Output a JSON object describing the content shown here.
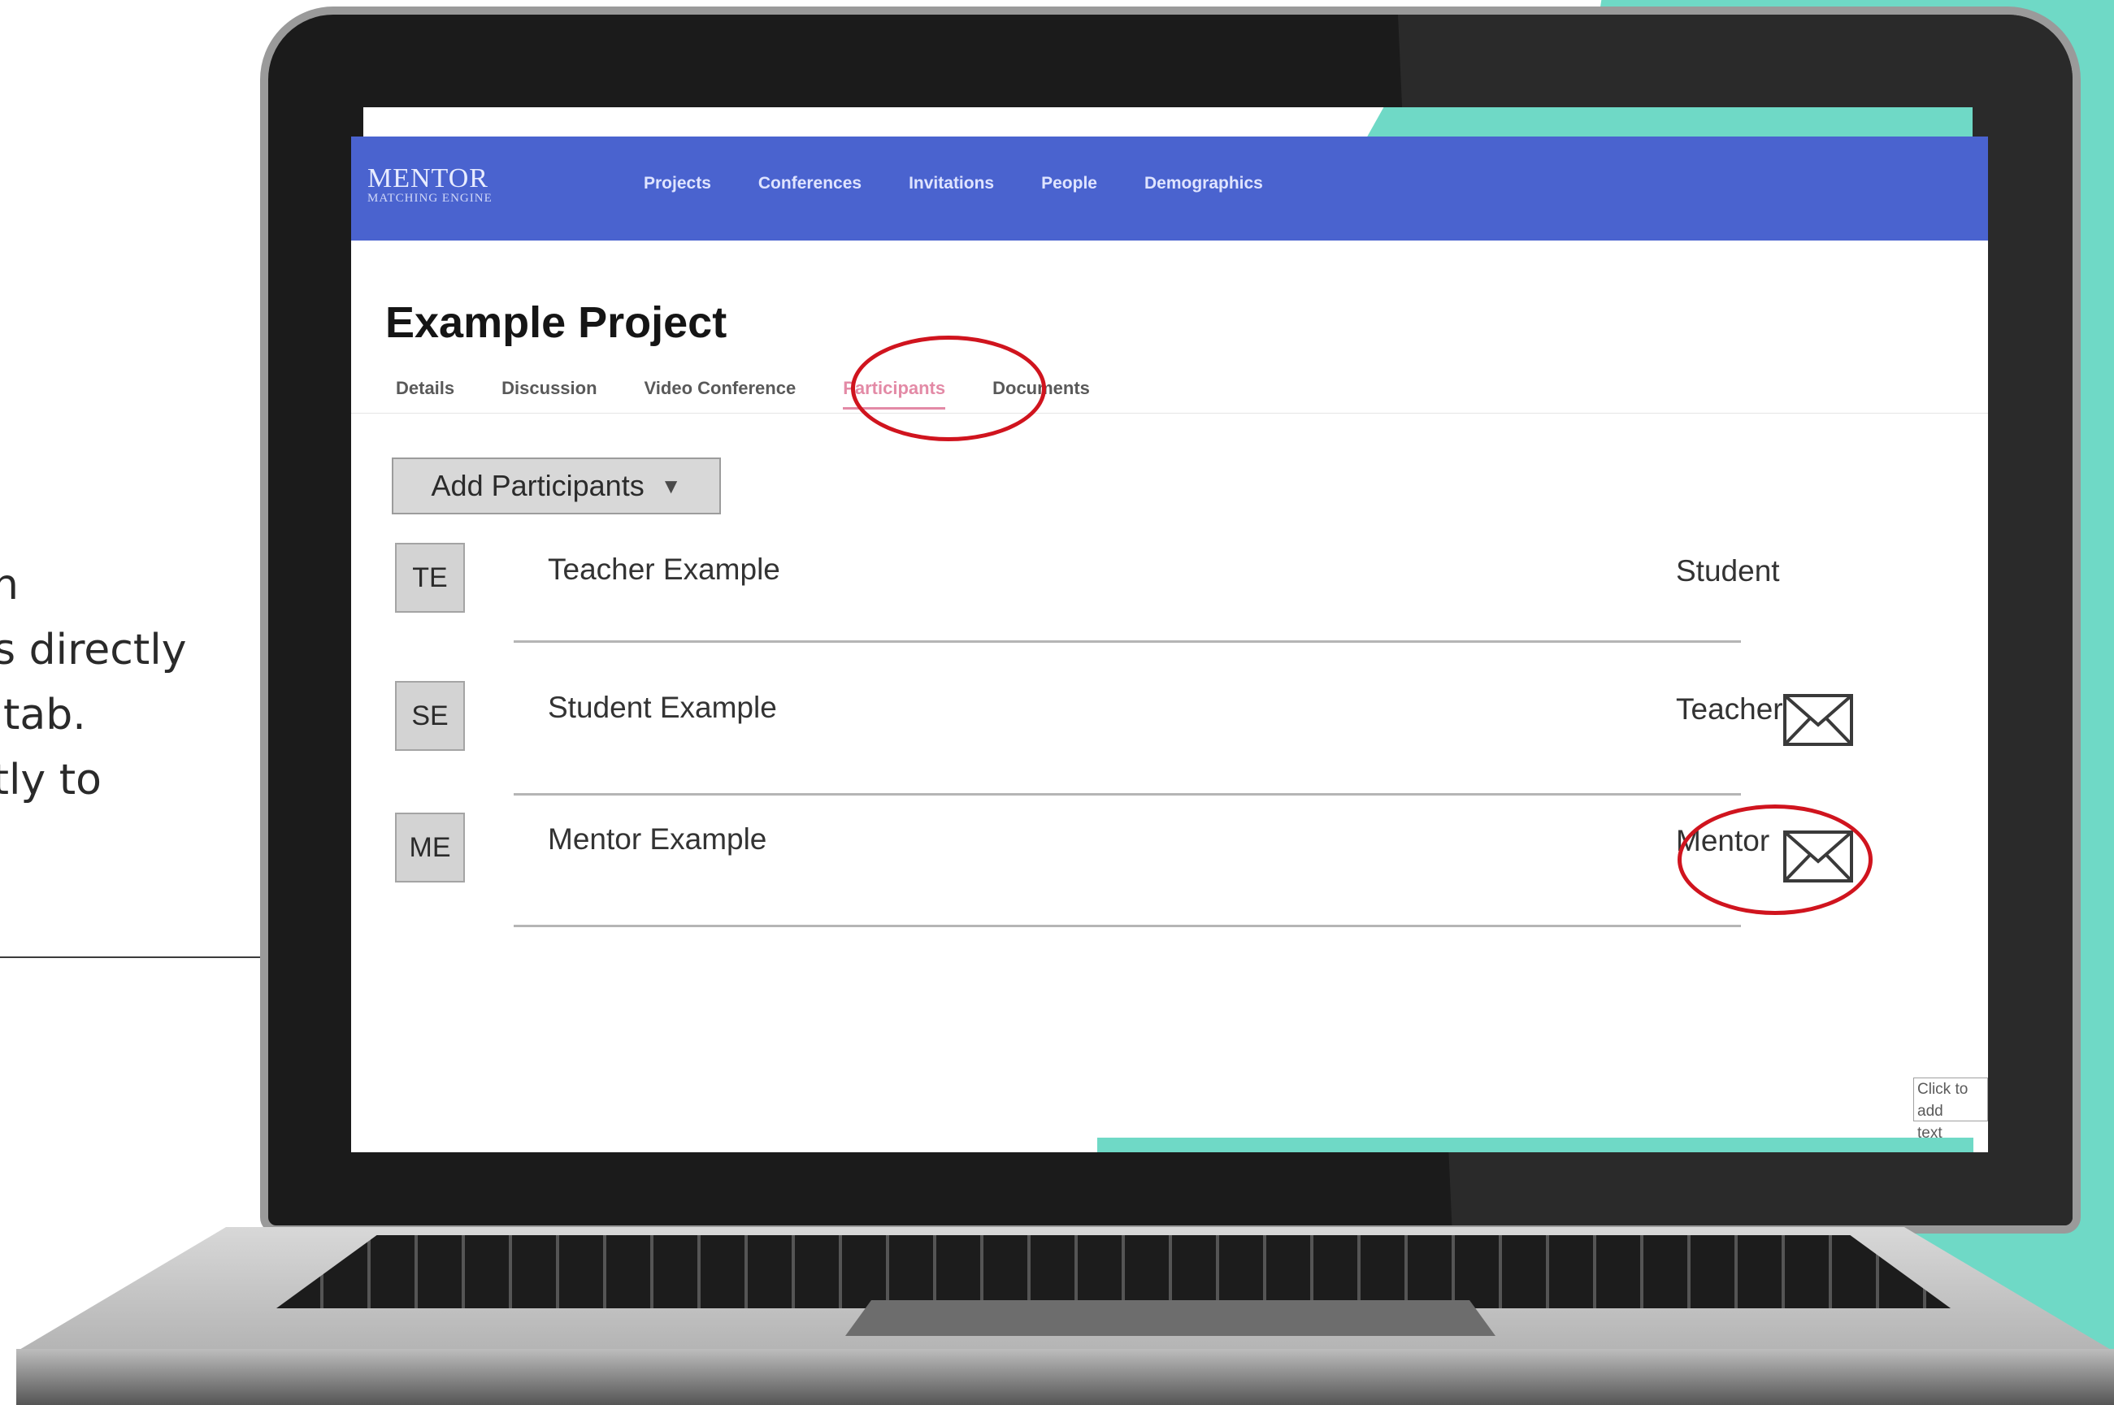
{
  "caption": {
    "lines": [
      "n",
      "es directly",
      "ts tab.",
      "ectly to"
    ]
  },
  "app": {
    "logo": {
      "main": "MENTOR",
      "sub": "MATCHING ENGINE"
    },
    "nav": [
      "Projects",
      "Conferences",
      "Invitations",
      "People",
      "Demographics"
    ],
    "page_title": "Example Project",
    "tabs": [
      "Details",
      "Discussion",
      "Video Conference",
      "Participants",
      "Documents"
    ],
    "active_tab": "Participants",
    "add_button": {
      "label": "Add Participants",
      "caret": "▼"
    },
    "participants": [
      {
        "initials": "TE",
        "name": "Teacher Example",
        "role": "Student",
        "has_mail": false
      },
      {
        "initials": "SE",
        "name": "Student Example",
        "role": "Teacher",
        "has_mail": true
      },
      {
        "initials": "ME",
        "name": "Mentor Example",
        "role": "Mentor",
        "has_mail": true
      }
    ],
    "textbox": {
      "line1": "Click to add",
      "line2": "text"
    }
  },
  "colors": {
    "navbar": "#4a63cf",
    "accent_teal": "#6fd9c6",
    "highlight_red": "#d0141e",
    "active_tab": "#e38aa6"
  },
  "icons": [
    "envelope-icon",
    "caret-down-icon"
  ]
}
